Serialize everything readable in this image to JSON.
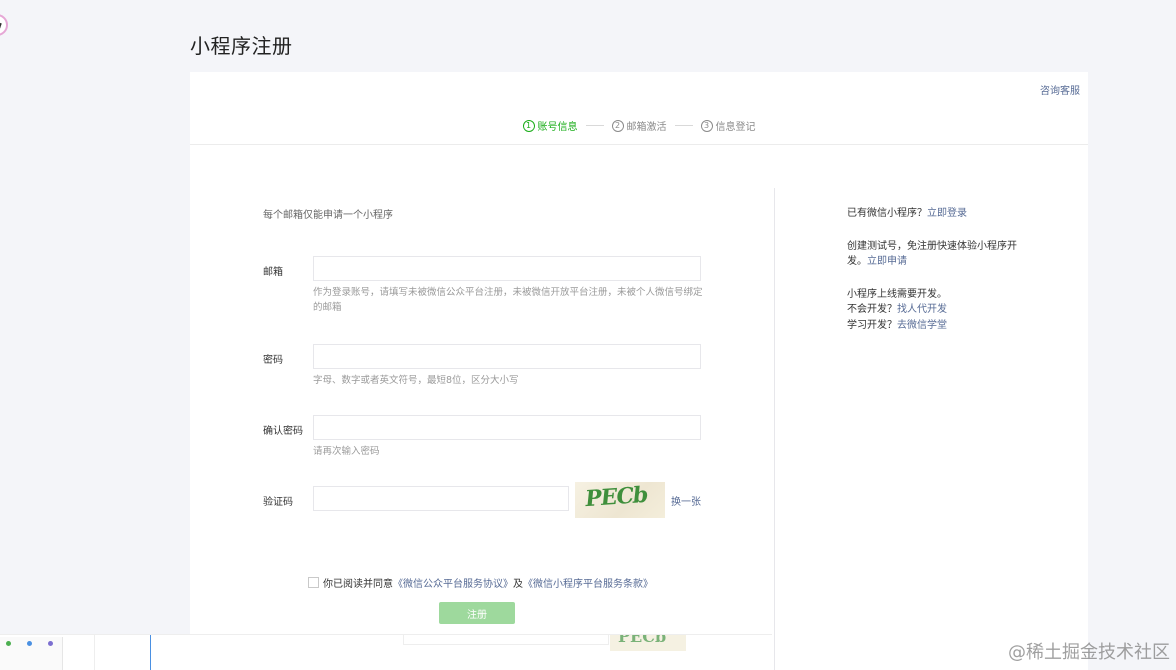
{
  "page": {
    "title": "小程序注册"
  },
  "header": {
    "help_link": "咨询客服"
  },
  "steps": [
    {
      "num": "1",
      "label": "账号信息",
      "active": true
    },
    {
      "num": "2",
      "label": "邮箱激活",
      "active": false
    },
    {
      "num": "3",
      "label": "信息登记",
      "active": false
    }
  ],
  "form": {
    "intro": "每个邮箱仅能申请一个小程序",
    "email": {
      "label": "邮箱",
      "value": "",
      "hint": "作为登录账号，请填写未被微信公众平台注册，未被微信开放平台注册，未被个人微信号绑定的邮箱"
    },
    "password": {
      "label": "密码",
      "value": "",
      "hint": "字母、数字或者英文符号，最短8位，区分大小写"
    },
    "confirm_password": {
      "label": "确认密码",
      "value": "",
      "hint": "请再次输入密码"
    },
    "captcha": {
      "label": "验证码",
      "value": "",
      "image_text": "PECb",
      "refresh_label": "换一张"
    },
    "agreement": {
      "prefix": "你已阅读并同意",
      "link1": "《微信公众平台服务协议》",
      "middle": "及",
      "link2": "《微信小程序平台服务条款》"
    },
    "submit_label": "注册"
  },
  "side": {
    "has_account_text": "已有微信小程序？",
    "login_link": "立即登录",
    "test_text_line1": "创建测试号，免注册快速体验小程序开",
    "test_text_line2": "发。",
    "test_link": "立即申请",
    "dev_line1": "小程序上线需要开发。",
    "dev_line2_prefix": "不会开发？",
    "dev_line2_link": "找人代开发",
    "dev_line3_prefix": "学习开发？",
    "dev_line3_link": "去微信学堂"
  },
  "ghost": {
    "captcha_text": "PECb"
  },
  "watermark": "@稀土掘金技术社区",
  "colors": {
    "accent_green": "#1aad19",
    "link_blue": "#576b95",
    "disabled_button": "#9ed99d"
  }
}
